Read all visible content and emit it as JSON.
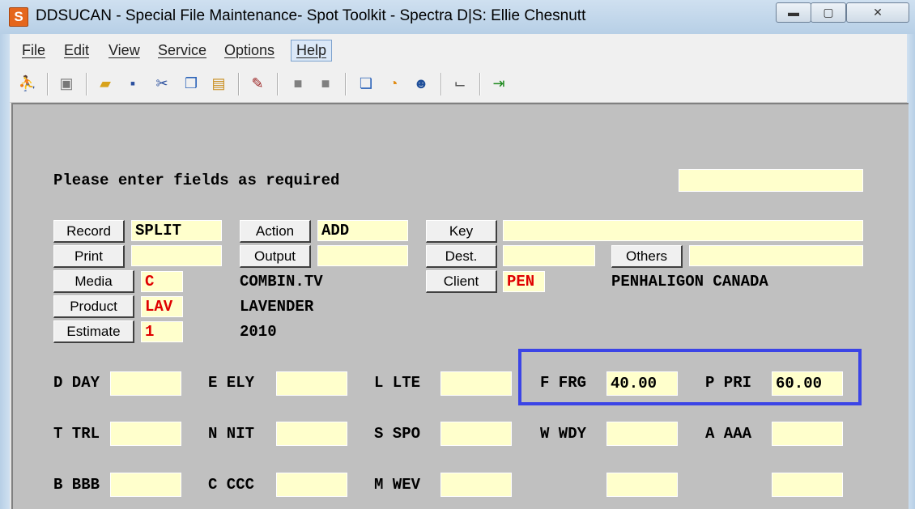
{
  "window": {
    "icon_letter": "S",
    "title": "DDSUCAN - Special File Maintenance- Spot Toolkit - Spectra D|S: Ellie Chesnutt",
    "min_label": "▬",
    "max_label": "▢",
    "close_label": "✕"
  },
  "menu": [
    "File",
    "Edit",
    "View",
    "Service",
    "Options",
    "Help"
  ],
  "toolbar_icons": [
    "person-icon",
    "device-icon",
    "open-folder-icon",
    "save-icon",
    "cut-icon",
    "copy-icon",
    "paste-icon",
    "tag-icon",
    "gray-box-icon",
    "gray-box-icon",
    "documents-icon",
    "timer-icon",
    "users-icon",
    "window-icon",
    "exit-icon"
  ],
  "form": {
    "prompt": "Please enter fields as required",
    "prompt_field": "",
    "record": {
      "label": "Record",
      "value": "SPLIT"
    },
    "action": {
      "label": "Action",
      "value": "ADD"
    },
    "key": {
      "label": "Key",
      "value": ""
    },
    "print": {
      "label": "Print",
      "value": ""
    },
    "output": {
      "label": "Output",
      "value": ""
    },
    "dest": {
      "label": "Dest.",
      "value": ""
    },
    "others": {
      "label": "Others",
      "value": ""
    },
    "media": {
      "label": "Media",
      "value": "C",
      "desc": "COMBIN.TV"
    },
    "client": {
      "label": "Client",
      "value": "PEN",
      "desc": "PENHALIGON CANADA"
    },
    "product": {
      "label": "Product",
      "value": "LAV",
      "desc": "LAVENDER"
    },
    "estimate": {
      "label": "Estimate",
      "value": "1",
      "desc": "2010"
    }
  },
  "dayparts": [
    {
      "label": "D DAY",
      "value": ""
    },
    {
      "label": "E ELY",
      "value": ""
    },
    {
      "label": "L LTE",
      "value": ""
    },
    {
      "label": "F FRG",
      "value": "40.00"
    },
    {
      "label": "P PRI",
      "value": "60.00"
    },
    {
      "label": "T TRL",
      "value": ""
    },
    {
      "label": "N NIT",
      "value": ""
    },
    {
      "label": "S SPO",
      "value": ""
    },
    {
      "label": "W WDY",
      "value": ""
    },
    {
      "label": "A AAA",
      "value": ""
    },
    {
      "label": "B BBB",
      "value": ""
    },
    {
      "label": "C CCC",
      "value": ""
    },
    {
      "label": "M WEV",
      "value": ""
    },
    {
      "label": "",
      "value": ""
    },
    {
      "label": "",
      "value": ""
    }
  ]
}
